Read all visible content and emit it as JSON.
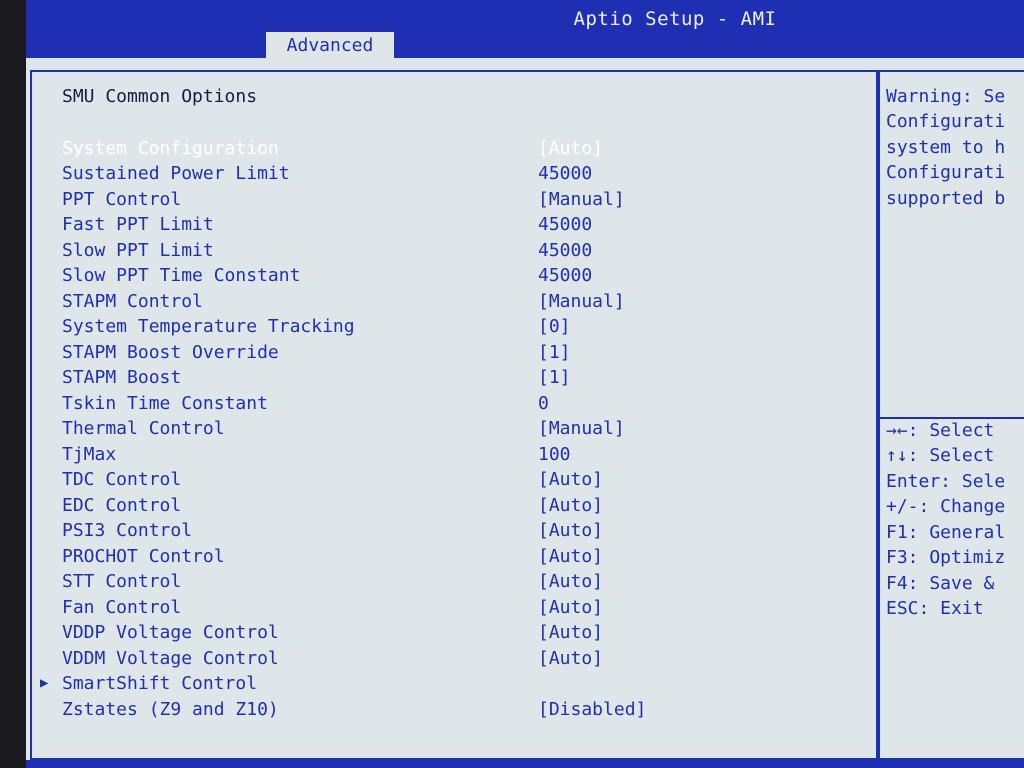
{
  "app": {
    "title": "Aptio Setup - AMI",
    "active_tab": "Advanced"
  },
  "section_title": "SMU Common Options",
  "options": [
    {
      "label": "System Configuration",
      "value": "[Auto]",
      "selected": true
    },
    {
      "label": "Sustained Power Limit",
      "value": "45000"
    },
    {
      "label": "PPT Control",
      "value": "[Manual]"
    },
    {
      "label": "Fast PPT Limit",
      "value": "45000"
    },
    {
      "label": "Slow PPT Limit",
      "value": "45000"
    },
    {
      "label": "Slow PPT Time Constant",
      "value": "45000"
    },
    {
      "label": "STAPM Control",
      "value": "[Manual]"
    },
    {
      "label": "System Temperature Tracking",
      "value": "[0]"
    },
    {
      "label": "STAPM Boost Override",
      "value": "[1]"
    },
    {
      "label": "STAPM Boost",
      "value": "[1]"
    },
    {
      "label": "Tskin Time Constant",
      "value": "0"
    },
    {
      "label": "Thermal Control",
      "value": "[Manual]"
    },
    {
      "label": "TjMax",
      "value": "100"
    },
    {
      "label": "TDC Control",
      "value": "[Auto]"
    },
    {
      "label": "EDC Control",
      "value": "[Auto]"
    },
    {
      "label": "PSI3 Control",
      "value": "[Auto]"
    },
    {
      "label": "PROCHOT Control",
      "value": "[Auto]"
    },
    {
      "label": "STT Control",
      "value": "[Auto]"
    },
    {
      "label": "Fan Control",
      "value": "[Auto]"
    },
    {
      "label": "VDDP Voltage Control",
      "value": "[Auto]"
    },
    {
      "label": "VDDM Voltage Control",
      "value": "[Auto]"
    },
    {
      "label": "SmartShift Control",
      "value": "",
      "submenu": true
    },
    {
      "label": "Zstates (Z9 and Z10)",
      "value": "[Disabled]"
    }
  ],
  "help": {
    "lines": [
      "Warning: Se",
      "Configurati",
      "system to h",
      "Configurati",
      "supported b"
    ]
  },
  "keys": [
    "→←: Select",
    "↑↓: Select",
    "Enter: Sele",
    "+/-: Change",
    "F1: General",
    "F3: Optimiz",
    "F4: Save &",
    "ESC: Exit"
  ],
  "colors": {
    "accent": "#1f2fb4",
    "background": "#dfe6ea",
    "highlight": "#ffffff"
  }
}
